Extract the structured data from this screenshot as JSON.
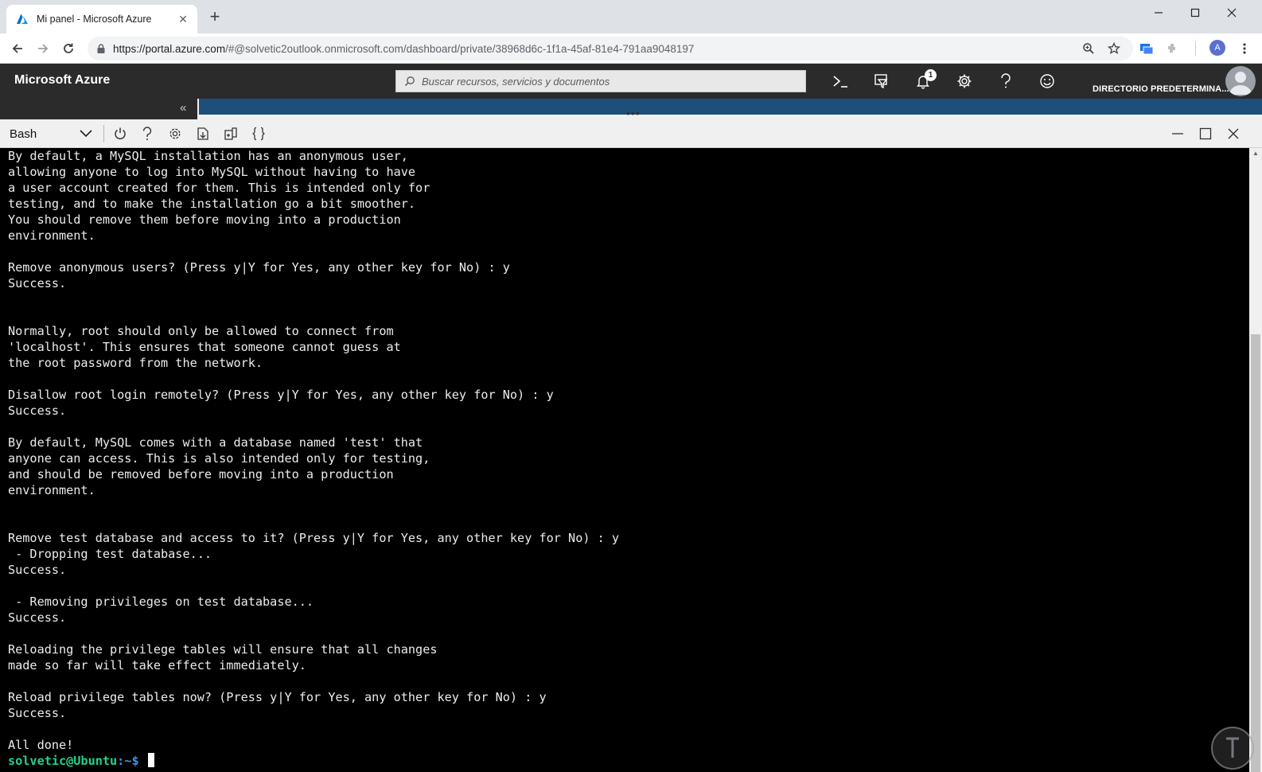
{
  "browser": {
    "tab_title": "Mi panel - Microsoft Azure",
    "url_host": "https://portal.azure.com",
    "url_rest": "/#@solvetic2outlook.onmicrosoft.com/dashboard/private/38968d6c-1f1a-45af-81e4-791aa9048197",
    "profile_initial": "A"
  },
  "azure": {
    "brand": "Microsoft Azure",
    "search_placeholder": "Buscar recursos, servicios y documentos",
    "notifications_count": "1",
    "directory": "DIRECTORIO PREDETERMINA..."
  },
  "shell": {
    "type": "Bash"
  },
  "terminal": {
    "lines": [
      "By default, a MySQL installation has an anonymous user,",
      "allowing anyone to log into MySQL without having to have",
      "a user account created for them. This is intended only for",
      "testing, and to make the installation go a bit smoother.",
      "You should remove them before moving into a production",
      "environment.",
      "",
      "Remove anonymous users? (Press y|Y for Yes, any other key for No) : y",
      "Success.",
      "",
      "",
      "Normally, root should only be allowed to connect from",
      "'localhost'. This ensures that someone cannot guess at",
      "the root password from the network.",
      "",
      "Disallow root login remotely? (Press y|Y for Yes, any other key for No) : y",
      "Success.",
      "",
      "By default, MySQL comes with a database named 'test' that",
      "anyone can access. This is also intended only for testing,",
      "and should be removed before moving into a production",
      "environment.",
      "",
      "",
      "Remove test database and access to it? (Press y|Y for Yes, any other key for No) : y",
      " - Dropping test database...",
      "Success.",
      "",
      " - Removing privileges on test database...",
      "Success.",
      "",
      "Reloading the privilege tables will ensure that all changes",
      "made so far will take effect immediately.",
      "",
      "Reload privilege tables now? (Press y|Y for Yes, any other key for No) : y",
      "Success.",
      "",
      "All done!"
    ],
    "prompt_user": "solvetic@Ubuntu",
    "prompt_path": ":~$"
  },
  "colors": {
    "azure_header": "#2b2b2b",
    "terminal_bg": "#000000",
    "prompt_green": "#23d18b",
    "prompt_blue": "#3b8eea"
  }
}
